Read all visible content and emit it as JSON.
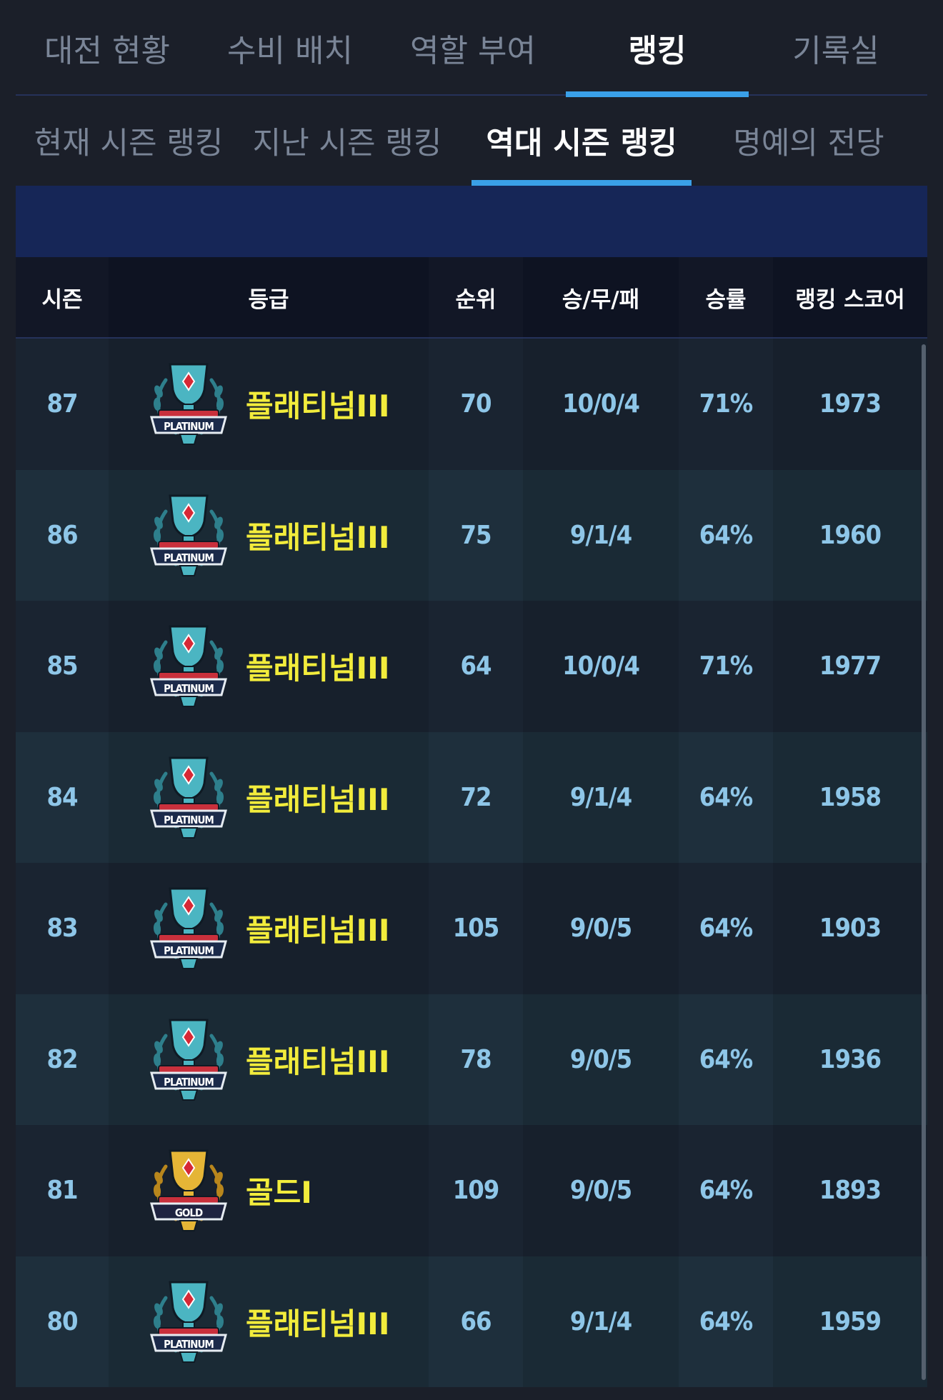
{
  "top_tabs": [
    {
      "label": "대전 현황"
    },
    {
      "label": "수비 배치"
    },
    {
      "label": "역할 부여"
    },
    {
      "label": "랭킹"
    },
    {
      "label": "기록실"
    }
  ],
  "sub_tabs": [
    {
      "label": "현재 시즌 랭킹"
    },
    {
      "label": "지난 시즌 랭킹"
    },
    {
      "label": "역대 시즌 랭킹"
    },
    {
      "label": "명예의 전당"
    }
  ],
  "table": {
    "headers": {
      "season": "시즌",
      "grade": "등급",
      "rank": "순위",
      "wdl": "승/무/패",
      "winrate": "승률",
      "score": "랭킹 스코어"
    },
    "rows": [
      {
        "season": "87",
        "grade": "플래티넘III",
        "emblem": "platinum",
        "emblem_text": "PLATINUM",
        "rank": "70",
        "wdl": "10/0/4",
        "winrate": "71%",
        "score": "1973"
      },
      {
        "season": "86",
        "grade": "플래티넘III",
        "emblem": "platinum",
        "emblem_text": "PLATINUM",
        "rank": "75",
        "wdl": "9/1/4",
        "winrate": "64%",
        "score": "1960"
      },
      {
        "season": "85",
        "grade": "플래티넘III",
        "emblem": "platinum",
        "emblem_text": "PLATINUM",
        "rank": "64",
        "wdl": "10/0/4",
        "winrate": "71%",
        "score": "1977"
      },
      {
        "season": "84",
        "grade": "플래티넘III",
        "emblem": "platinum",
        "emblem_text": "PLATINUM",
        "rank": "72",
        "wdl": "9/1/4",
        "winrate": "64%",
        "score": "1958"
      },
      {
        "season": "83",
        "grade": "플래티넘III",
        "emblem": "platinum",
        "emblem_text": "PLATINUM",
        "rank": "105",
        "wdl": "9/0/5",
        "winrate": "64%",
        "score": "1903"
      },
      {
        "season": "82",
        "grade": "플래티넘III",
        "emblem": "platinum",
        "emblem_text": "PLATINUM",
        "rank": "78",
        "wdl": "9/0/5",
        "winrate": "64%",
        "score": "1936"
      },
      {
        "season": "81",
        "grade": "골드I",
        "emblem": "gold",
        "emblem_text": "GOLD",
        "rank": "109",
        "wdl": "9/0/5",
        "winrate": "64%",
        "score": "1893"
      },
      {
        "season": "80",
        "grade": "플래티넘III",
        "emblem": "platinum",
        "emblem_text": "PLATINUM",
        "rank": "66",
        "wdl": "9/1/4",
        "winrate": "64%",
        "score": "1959"
      }
    ]
  },
  "colors": {
    "accent": "#3aa0e8",
    "grade_text": "#f2ec3c",
    "value_text": "#8ec6e8",
    "band": "#162657"
  }
}
